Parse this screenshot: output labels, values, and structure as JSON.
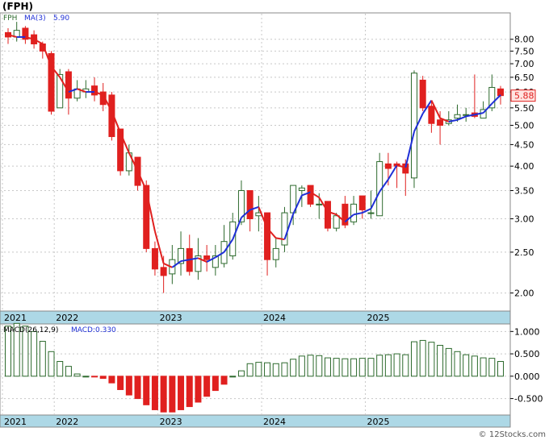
{
  "header": {
    "ticker_title": "(FPH)"
  },
  "price_panel": {
    "legend_symbol": "FPH",
    "legend_ma": "MA(3)",
    "legend_ma_value": "5.90",
    "last_price_label": "5.88"
  },
  "macd_panel": {
    "legend_params": "MACD(26,12,9)",
    "legend_value": "MACD:0.330"
  },
  "watermark": "© 12Stocks.com",
  "colors": {
    "up": "#2d6a2d",
    "down": "#e0201f",
    "ma_up": "#1f2fd6",
    "ma_down": "#e0201f",
    "axis_band": "#add8e6",
    "grid": "#c8c8c8"
  },
  "chart_data": [
    {
      "type": "candlestick",
      "title": "(FPH)",
      "scale": "log",
      "ylim": [
        1.82,
        9.2
      ],
      "y_ticks": [
        "8.00",
        "7.50",
        "7.00",
        "6.50",
        "6.00",
        "5.50",
        "5.00",
        "4.50",
        "4.00",
        "3.50",
        "3.00",
        "2.50",
        "2.00"
      ],
      "x_tick_labels": [
        "2021",
        "2022",
        "2023",
        "2024",
        "2025"
      ],
      "series": [
        {
          "name": "FPH",
          "candles": [
            [
              8.3,
              8.1,
              8.5,
              7.8
            ],
            [
              8.1,
              8.4,
              8.8,
              7.9
            ],
            [
              8.5,
              8.0,
              8.6,
              7.8
            ],
            [
              8.2,
              7.8,
              8.4,
              7.6
            ],
            [
              7.8,
              7.5,
              7.9,
              7.2
            ],
            [
              7.4,
              5.4,
              7.5,
              5.3
            ],
            [
              5.5,
              6.6,
              6.8,
              5.5
            ],
            [
              6.7,
              5.8,
              6.8,
              5.3
            ],
            [
              5.8,
              6.1,
              6.4,
              5.7
            ],
            [
              6.0,
              6.1,
              6.4,
              5.8
            ],
            [
              6.2,
              5.9,
              6.5,
              5.7
            ],
            [
              6.0,
              5.6,
              6.3,
              5.4
            ],
            [
              5.9,
              4.7,
              6.0,
              4.6
            ],
            [
              4.9,
              3.9,
              4.9,
              3.8
            ],
            [
              3.9,
              4.3,
              4.5,
              3.8
            ],
            [
              4.2,
              3.6,
              4.2,
              3.5
            ],
            [
              3.6,
              2.55,
              3.7,
              2.5
            ],
            [
              2.55,
              2.28,
              2.65,
              2.2
            ],
            [
              2.3,
              2.2,
              2.45,
              2.0
            ],
            [
              2.22,
              2.4,
              2.6,
              2.1
            ],
            [
              2.35,
              2.55,
              2.8,
              2.2
            ],
            [
              2.55,
              2.25,
              2.75,
              2.2
            ],
            [
              2.25,
              2.45,
              2.7,
              2.15
            ],
            [
              2.45,
              2.4,
              2.6,
              2.25
            ],
            [
              2.3,
              2.45,
              2.6,
              2.2
            ],
            [
              2.35,
              2.65,
              2.9,
              2.3
            ],
            [
              2.45,
              2.95,
              3.1,
              2.4
            ],
            [
              2.95,
              3.5,
              3.7,
              2.9
            ],
            [
              3.5,
              3.0,
              3.5,
              2.8
            ],
            [
              3.05,
              3.1,
              3.4,
              2.8
            ],
            [
              3.1,
              2.4,
              3.1,
              2.2
            ],
            [
              2.4,
              2.55,
              2.7,
              2.3
            ],
            [
              2.6,
              3.1,
              3.2,
              2.5
            ],
            [
              3.1,
              3.6,
              3.6,
              2.9
            ],
            [
              3.5,
              3.55,
              3.6,
              3.2
            ],
            [
              3.6,
              3.25,
              3.6,
              3.2
            ],
            [
              3.25,
              3.25,
              3.45,
              3.0
            ],
            [
              3.3,
              2.85,
              3.3,
              2.8
            ],
            [
              2.85,
              3.05,
              3.1,
              2.8
            ],
            [
              3.25,
              2.9,
              3.4,
              2.85
            ],
            [
              2.95,
              3.25,
              3.4,
              2.9
            ],
            [
              3.4,
              3.15,
              3.4,
              3.0
            ],
            [
              3.1,
              3.1,
              3.5,
              3.0
            ],
            [
              3.05,
              4.1,
              4.3,
              3.05
            ],
            [
              4.05,
              3.95,
              4.3,
              3.6
            ],
            [
              4.05,
              4.0,
              4.1,
              3.55
            ],
            [
              4.05,
              3.85,
              4.15,
              3.4
            ],
            [
              3.75,
              6.65,
              6.75,
              3.55
            ],
            [
              6.4,
              5.5,
              6.55,
              5.4
            ],
            [
              5.55,
              5.05,
              5.7,
              4.8
            ],
            [
              5.15,
              5.0,
              5.4,
              4.5
            ],
            [
              5.05,
              5.15,
              5.4,
              5.0
            ],
            [
              5.2,
              5.3,
              5.6,
              5.1
            ],
            [
              5.3,
              5.3,
              5.5,
              5.1
            ],
            [
              5.35,
              5.25,
              6.6,
              5.2
            ],
            [
              5.2,
              5.45,
              5.7,
              5.2
            ],
            [
              5.5,
              6.15,
              6.6,
              5.4
            ],
            [
              6.1,
              5.88,
              6.2,
              5.6
            ]
          ]
        },
        {
          "name": "MA(3)",
          "values": [
            8.2,
            8.1,
            8.1,
            8.0,
            7.8,
            6.9,
            6.5,
            6.0,
            6.1,
            6.0,
            6.0,
            5.9,
            5.4,
            4.8,
            4.3,
            3.9,
            3.5,
            2.8,
            2.35,
            2.3,
            2.38,
            2.4,
            2.42,
            2.37,
            2.43,
            2.5,
            2.68,
            3.02,
            3.15,
            3.2,
            2.85,
            2.7,
            2.68,
            3.08,
            3.41,
            3.47,
            3.37,
            3.12,
            3.07,
            2.95,
            3.07,
            3.1,
            3.17,
            3.48,
            3.72,
            4.02,
            3.97,
            4.83,
            5.33,
            5.73,
            5.2,
            5.1,
            5.15,
            5.25,
            5.3,
            5.35,
            5.63,
            5.9
          ]
        }
      ]
    },
    {
      "type": "bar",
      "title": "MACD(26,12,9)",
      "ylim": [
        -0.85,
        1.15
      ],
      "y_ticks": [
        "1.000",
        "0.500",
        "0.000",
        "-0.500"
      ],
      "x_tick_labels": [
        "2021",
        "2022",
        "2023",
        "2024",
        "2025"
      ],
      "series": [
        {
          "name": "MACD",
          "values": [
            1.12,
            1.18,
            1.12,
            1.0,
            0.78,
            0.55,
            0.33,
            0.22,
            0.05,
            0.0,
            -0.01,
            -0.05,
            -0.15,
            -0.3,
            -0.42,
            -0.5,
            -0.64,
            -0.75,
            -0.8,
            -0.8,
            -0.75,
            -0.68,
            -0.58,
            -0.45,
            -0.32,
            -0.18,
            0.0,
            0.12,
            0.28,
            0.31,
            0.3,
            0.28,
            0.3,
            0.38,
            0.45,
            0.47,
            0.46,
            0.41,
            0.4,
            0.39,
            0.39,
            0.4,
            0.4,
            0.47,
            0.48,
            0.5,
            0.48,
            0.77,
            0.8,
            0.76,
            0.69,
            0.62,
            0.55,
            0.48,
            0.45,
            0.41,
            0.4,
            0.33
          ]
        }
      ]
    }
  ]
}
